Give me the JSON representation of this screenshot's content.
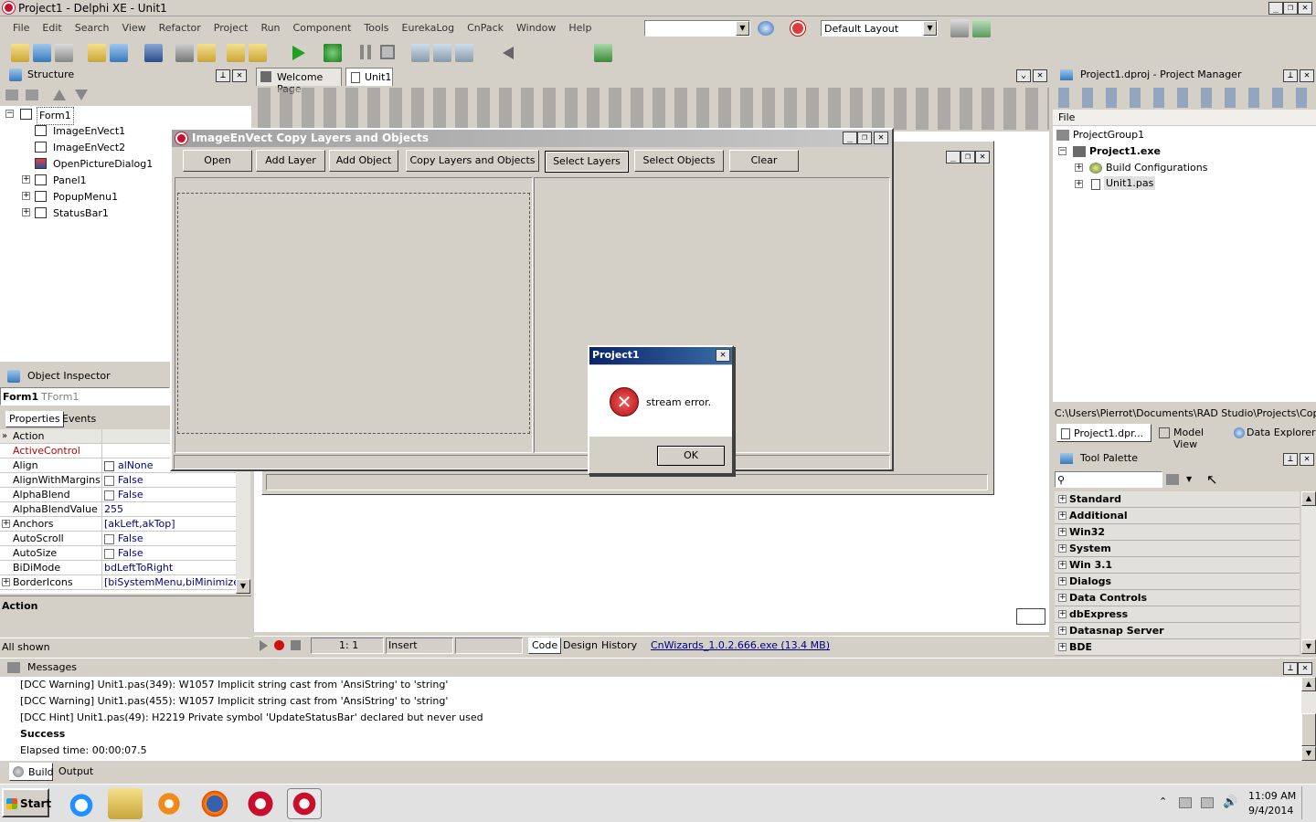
{
  "window": {
    "title": "Project1 - Delphi XE - Unit1"
  },
  "menu": [
    "File",
    "Edit",
    "Search",
    "View",
    "Refactor",
    "Project",
    "Run",
    "Component",
    "Tools",
    "EurekaLog",
    "CnPack",
    "Window",
    "Help"
  ],
  "toolbar": {
    "layout_combo": "Default Layout"
  },
  "structure": {
    "title": "Structure",
    "items": [
      "Form1",
      "ImageEnVect1",
      "ImageEnVect2",
      "OpenPictureDialog1",
      "Panel1",
      "PopupMenu1",
      "StatusBar1"
    ]
  },
  "editor": {
    "tabs": [
      "Welcome Page",
      "Unit1"
    ]
  },
  "form": {
    "title": "ImageEnVect Copy Layers and Objects",
    "buttons": [
      "Open",
      "Add Layer",
      "Add Object",
      "Copy Layers and Objects",
      "Select Layers",
      "Select Objects",
      "Clear"
    ]
  },
  "dialog": {
    "title": "Project1",
    "message": "stream error.",
    "ok": "OK"
  },
  "inspector": {
    "title": "Object Inspector",
    "object": "Form1",
    "object_type": "TForm1",
    "tabs": [
      "Properties",
      "Events"
    ],
    "rows": [
      {
        "name": "Action",
        "value": ""
      },
      {
        "name": "ActiveControl",
        "value": ""
      },
      {
        "name": "Align",
        "value": "alNone"
      },
      {
        "name": "AlignWithMargins",
        "value": "False"
      },
      {
        "name": "AlphaBlend",
        "value": "False"
      },
      {
        "name": "AlphaBlendValue",
        "value": "255"
      },
      {
        "name": "Anchors",
        "value": "[akLeft,akTop]"
      },
      {
        "name": "AutoScroll",
        "value": "False"
      },
      {
        "name": "AutoSize",
        "value": "False"
      },
      {
        "name": "BiDiMode",
        "value": "bdLeftToRight"
      },
      {
        "name": "BorderIcons",
        "value": "[biSystemMenu,biMinimize,biM"
      }
    ],
    "desc": "Action",
    "status": "All shown"
  },
  "statusbar": {
    "pos": "1:  1",
    "mode": "Insert",
    "tabs": [
      "Code",
      "Design",
      "History"
    ],
    "link": "CnWizards_1.0.2.666.exe (13.4 MB)"
  },
  "project_manager": {
    "title": "Project1.dproj - Project Manager",
    "header": "File",
    "items": [
      "ProjectGroup1",
      "Project1.exe",
      "Build Configurations",
      "Unit1.pas"
    ],
    "path": "C:\\Users\\Pierrot\\Documents\\RAD Studio\\Projects\\CopyImag",
    "tabs": [
      "Project1.dpr...",
      "Model View",
      "Data Explorer"
    ]
  },
  "palette": {
    "title": "Tool Palette",
    "categories": [
      "Standard",
      "Additional",
      "Win32",
      "System",
      "Win 3.1",
      "Dialogs",
      "Data Controls",
      "dbExpress",
      "Datasnap Server",
      "BDE"
    ]
  },
  "messages": {
    "title": "Messages",
    "lines": [
      "[DCC Warning] Unit1.pas(349): W1057 Implicit string cast from 'AnsiString' to 'string'",
      "[DCC Warning] Unit1.pas(455): W1057 Implicit string cast from 'AnsiString' to 'string'",
      "[DCC Hint] Unit1.pas(49): H2219 Private symbol 'UpdateStatusBar' declared but never used",
      "Success",
      "Elapsed time: 00:00:07.5"
    ],
    "tabs": [
      "Build",
      "Output"
    ]
  },
  "taskbar": {
    "start": "Start",
    "time": "11:09 AM",
    "date": "9/4/2014"
  },
  "colors": {
    "selection": "#0a246a",
    "error": "#c8102e",
    "link": "#000080"
  }
}
